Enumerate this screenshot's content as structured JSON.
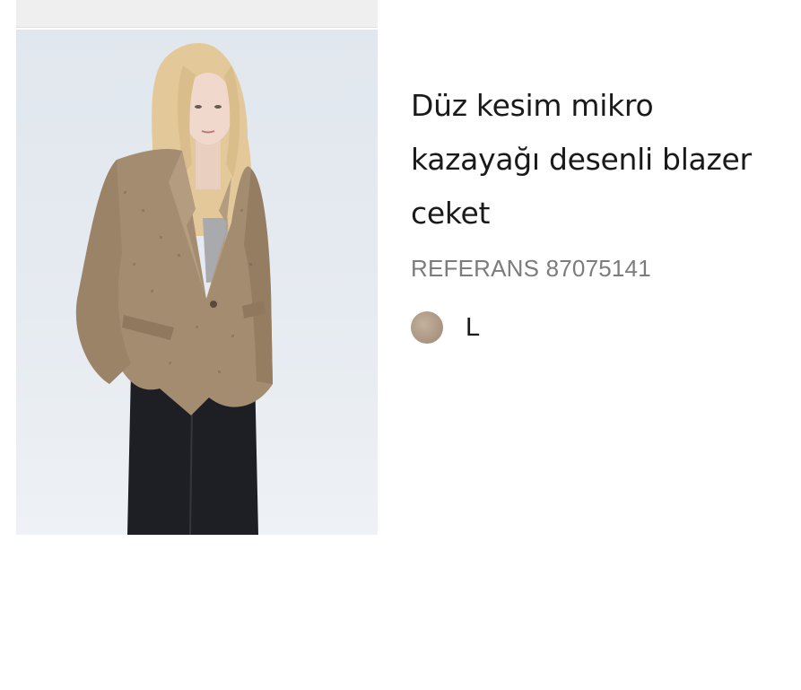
{
  "product": {
    "title_line1": "Düz kesim mikro",
    "title_line2": "kazayağı desenli blazer",
    "title_line3": "ceket",
    "reference": "REFERANS 87075141",
    "color_swatch_hex": "#a89481",
    "size": "L",
    "image_icon": "product-photo-model-blazer"
  },
  "colors": {
    "title": "#1a1a1a",
    "reference": "#7c7c7c",
    "image_bg": "#e4e9ef"
  }
}
